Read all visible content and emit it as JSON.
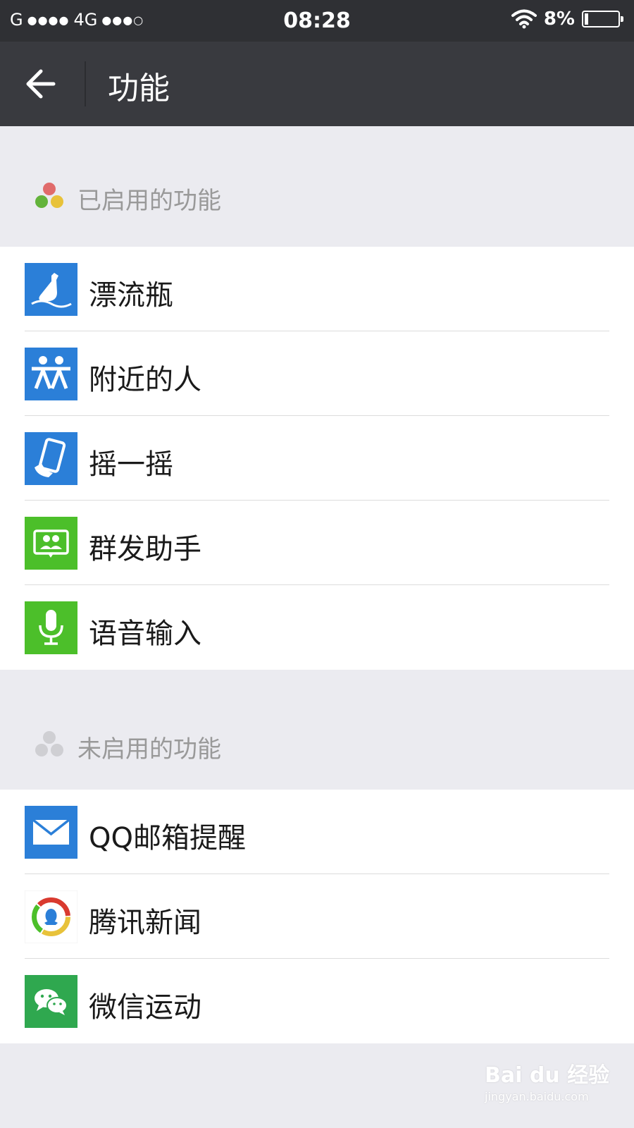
{
  "status_bar": {
    "carrier": "G",
    "network": "4G",
    "time": "08:28",
    "battery": "8%"
  },
  "header": {
    "title": "功能",
    "back_icon": "arrow-left-icon"
  },
  "enabled_section": {
    "label": "已启用的功能",
    "items": [
      {
        "label": "漂流瓶",
        "icon": "bottle-icon",
        "color": "#2b7fd8"
      },
      {
        "label": "附近的人",
        "icon": "people-nearby-icon",
        "color": "#2b7fd8"
      },
      {
        "label": "摇一摇",
        "icon": "shake-phone-icon",
        "color": "#2b7fd8"
      },
      {
        "label": "群发助手",
        "icon": "group-message-icon",
        "color": "#4cbf2a"
      },
      {
        "label": "语音输入",
        "icon": "microphone-icon",
        "color": "#4cbf2a"
      }
    ]
  },
  "disabled_section": {
    "label": "未启用的功能",
    "items": [
      {
        "label": "QQ邮箱提醒",
        "icon": "mail-icon",
        "color": "#2b7fd8"
      },
      {
        "label": "腾讯新闻",
        "icon": "tencent-news-icon",
        "color": "#ffffff"
      },
      {
        "label": "微信运动",
        "icon": "wechat-sport-icon",
        "color": "#2fa84f"
      }
    ]
  },
  "watermark": {
    "brand": "Bai du 经验",
    "url": "jingyan.baidu.com"
  }
}
